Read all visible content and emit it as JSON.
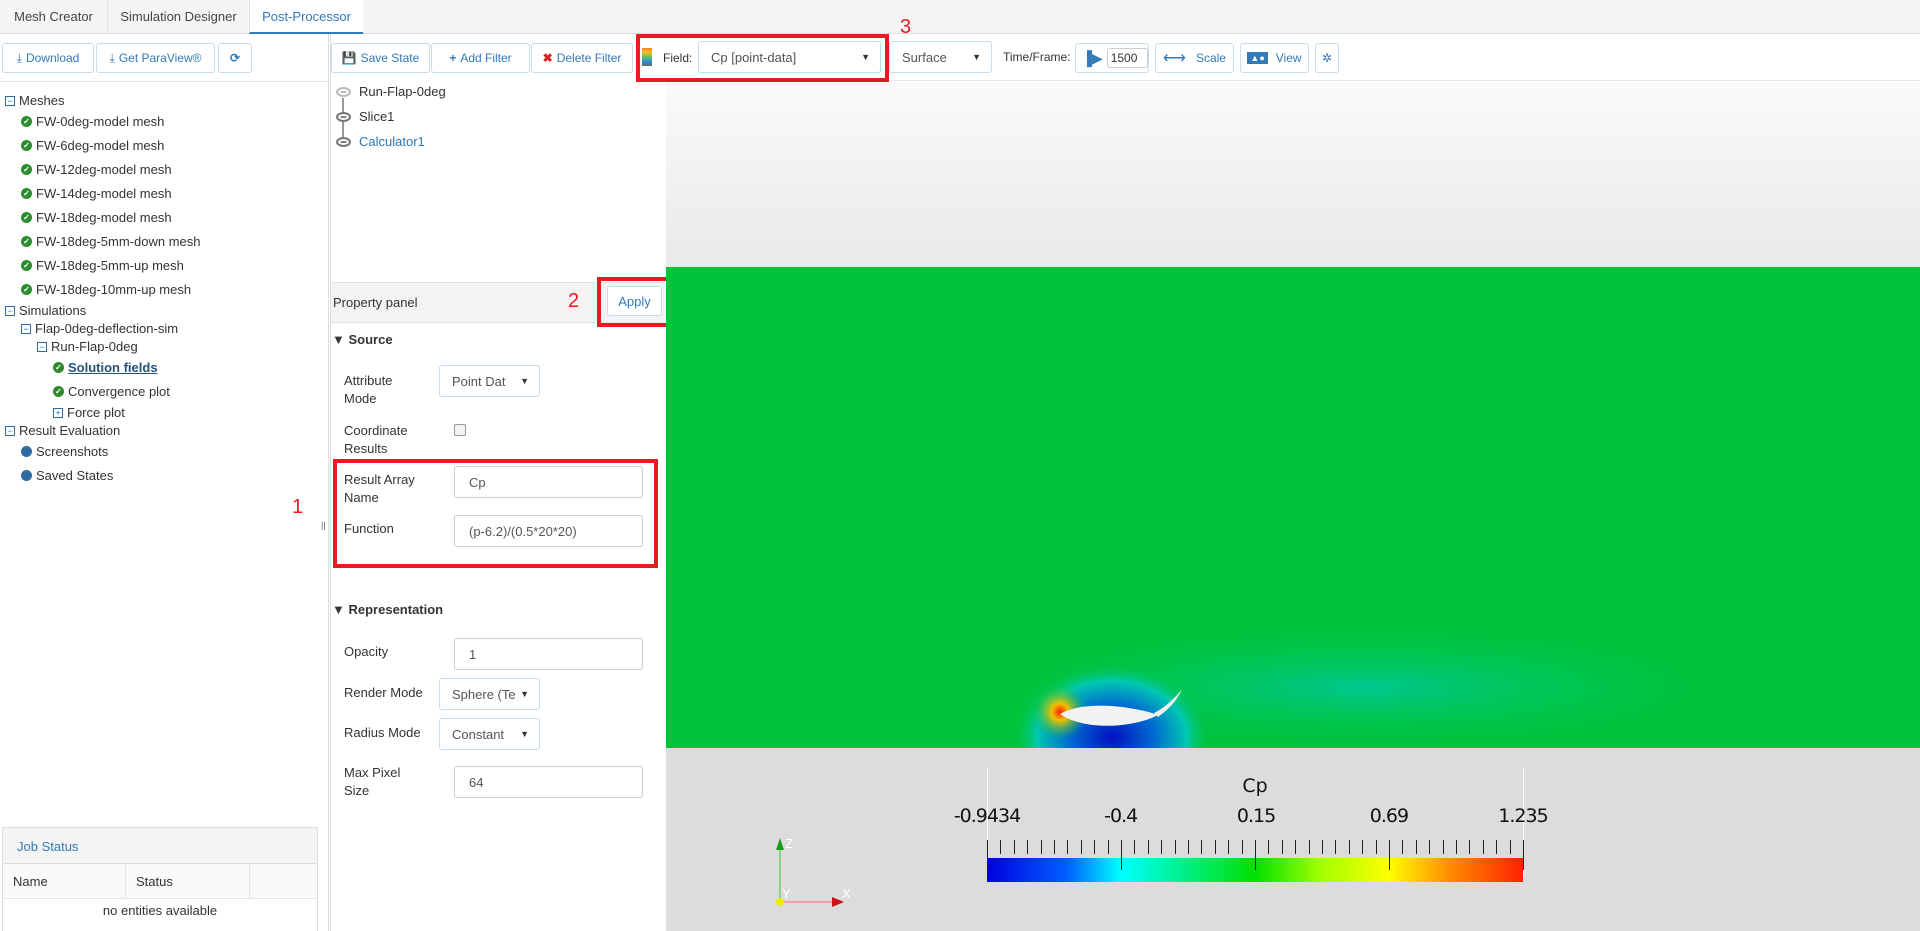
{
  "tabs": [
    {
      "label": "Mesh Creator"
    },
    {
      "label": "Simulation Designer"
    },
    {
      "label": "Post-Processor",
      "active": true
    }
  ],
  "left_toolbar": {
    "download": "Download",
    "get_paraview": "Get ParaView®",
    "refresh_icon": "refresh-icon"
  },
  "tree": {
    "meshes": {
      "label": "Meshes",
      "items": [
        "FW-0deg-model mesh",
        "FW-6deg-model mesh",
        "FW-12deg-model mesh",
        "FW-14deg-model mesh",
        "FW-18deg-model mesh",
        "FW-18deg-5mm-down mesh",
        "FW-18deg-5mm-up mesh",
        "FW-18deg-10mm-up mesh"
      ]
    },
    "simulations": {
      "label": "Simulations",
      "sim": "Flap-0deg-deflection-sim",
      "run": "Run-Flap-0deg",
      "children": [
        "Solution fields",
        "Convergence plot",
        "Force plot"
      ]
    },
    "result_evaluation": {
      "label": "Result Evaluation",
      "items": [
        "Screenshots",
        "Saved States"
      ]
    }
  },
  "job_status": {
    "title": "Job Status",
    "columns": [
      "Name",
      "Status",
      ""
    ],
    "empty": "no entities available"
  },
  "mid_toolbar": {
    "save_state": "Save State",
    "add_filter": "Add Filter",
    "delete_filter": "Delete Filter"
  },
  "pipeline": [
    "Run-Flap-0deg",
    "Slice1",
    "Calculator1"
  ],
  "property_panel": {
    "title": "Property panel",
    "apply": "Apply",
    "source": {
      "title": "Source",
      "attribute_mode_label": "Attribute Mode",
      "attribute_mode": "Point Dat",
      "coordinate_results_label": "Coordinate Results",
      "coordinate_results": false,
      "result_array_name_label": "Result Array Name",
      "result_array_name": "Cp",
      "function_label": "Function",
      "function": "(p-6.2)/(0.5*20*20)"
    },
    "representation": {
      "title": "Representation",
      "opacity_label": "Opacity",
      "opacity": "1",
      "render_mode_label": "Render Mode",
      "render_mode": "Sphere (Te",
      "radius_mode_label": "Radius Mode",
      "radius_mode": "Constant",
      "max_pixel_size_label": "Max Pixel Size",
      "max_pixel_size": "64"
    }
  },
  "view_toolbar": {
    "field_label": "Field:",
    "field": "Cp [point-data]",
    "representation": "Surface",
    "time_label": "Time/Frame:",
    "time": "1500",
    "scale": "Scale",
    "view": "View"
  },
  "annotations": [
    "1",
    "2",
    "3"
  ],
  "colorbar": {
    "title": "Cp",
    "range": [
      -0.9434,
      1.235
    ],
    "tick_labels": [
      "-0.9434",
      "-0.4",
      "0.15",
      "0.69",
      "1.235"
    ]
  },
  "axes": {
    "x": "X",
    "y": "Y",
    "z": "Z"
  },
  "colors": {
    "accent": "#337ab7",
    "highlight": "#e81b23",
    "field": "#00c43a"
  }
}
